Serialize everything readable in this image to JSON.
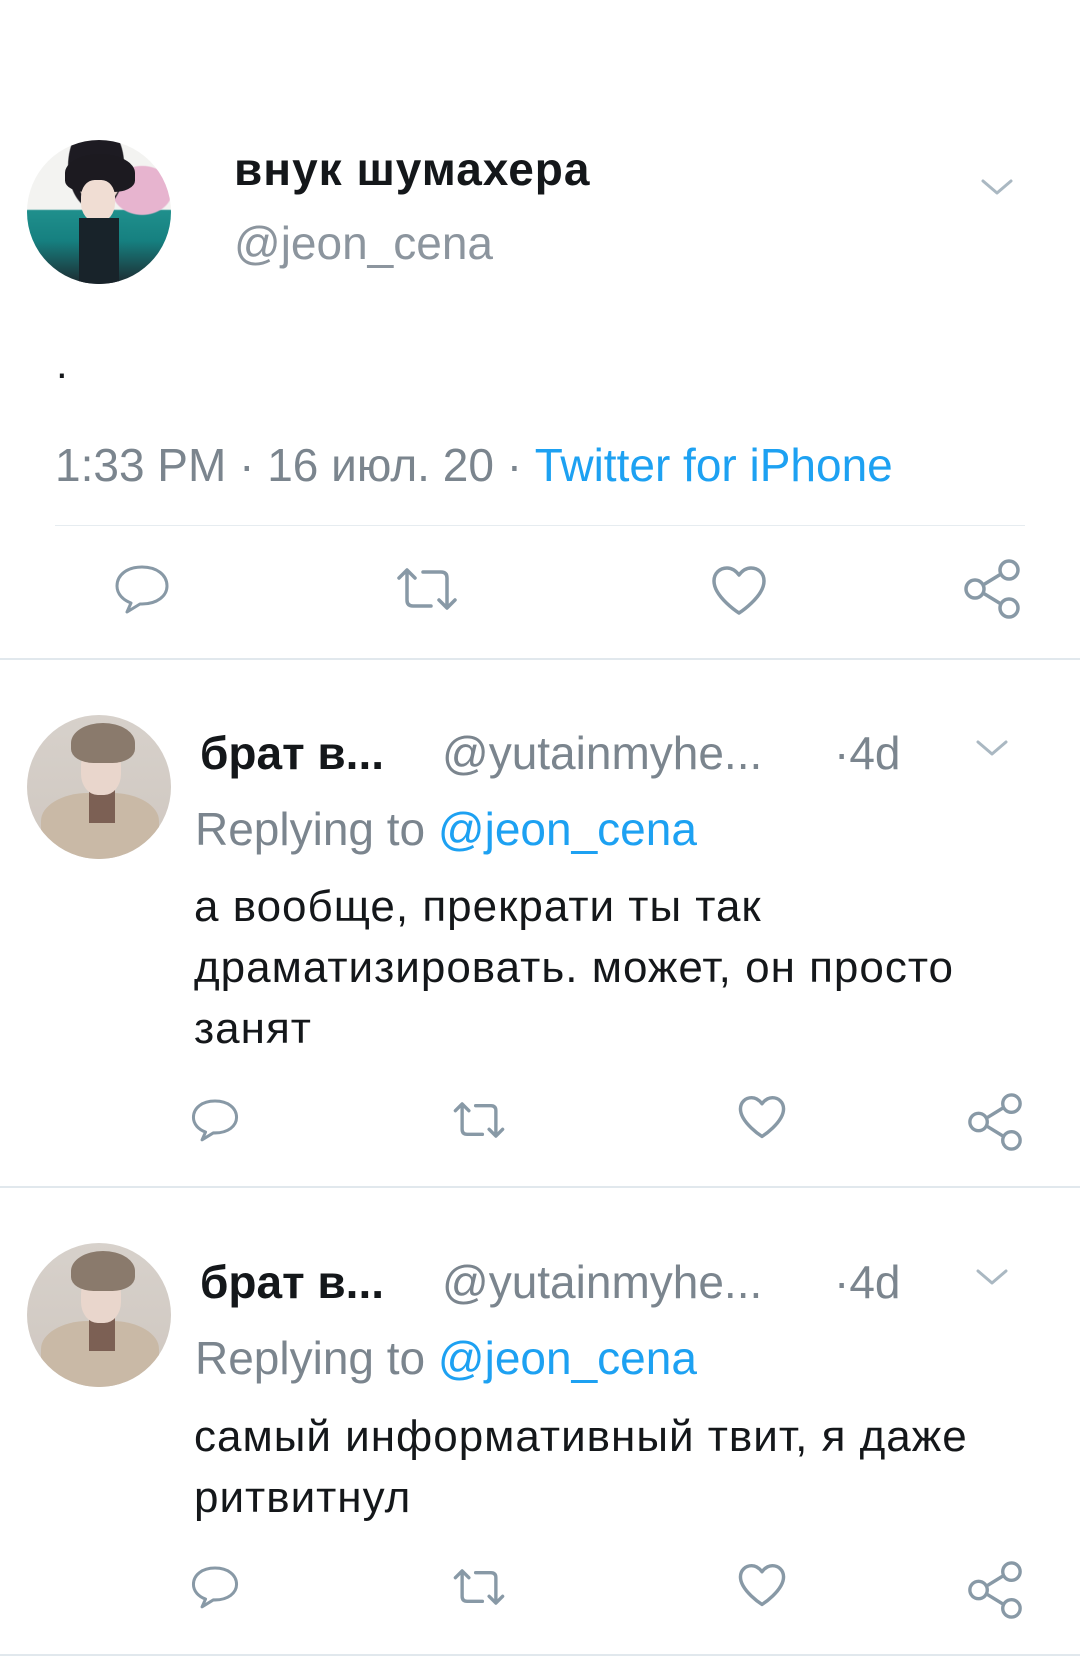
{
  "main_tweet": {
    "author_name": "внук шумахера",
    "author_handle": "@jeon_cena",
    "text": ".",
    "time": "1:33 PM",
    "date": "16 июл. 20",
    "source": "Twitter for iPhone",
    "separator": "·",
    "actions": {
      "reply_icon": "reply-bubble-icon",
      "retweet_icon": "retweet-icon",
      "like_icon": "heart-icon",
      "share_icon": "share-icon"
    }
  },
  "replies": [
    {
      "author_name": "брат в...",
      "author_handle": "@yutainmyhe...",
      "separator": "·",
      "time_ago": "4d",
      "replying_label": "Replying to",
      "replying_to": "@jeon_cena",
      "text": "а вообще, прекрати ты так драматизировать. может, он просто занят"
    },
    {
      "author_name": "брат в...",
      "author_handle": "@yutainmyhe...",
      "separator": "·",
      "time_ago": "4d",
      "replying_label": "Replying to",
      "replying_to": "@jeon_cena",
      "text": "самый информативный твит, я даже ритвитнул"
    }
  ],
  "colors": {
    "accent_blue": "#1da1f2",
    "secondary_text": "#7b858e",
    "icon_gray": "#657786",
    "divider": "#e6ecf0"
  }
}
